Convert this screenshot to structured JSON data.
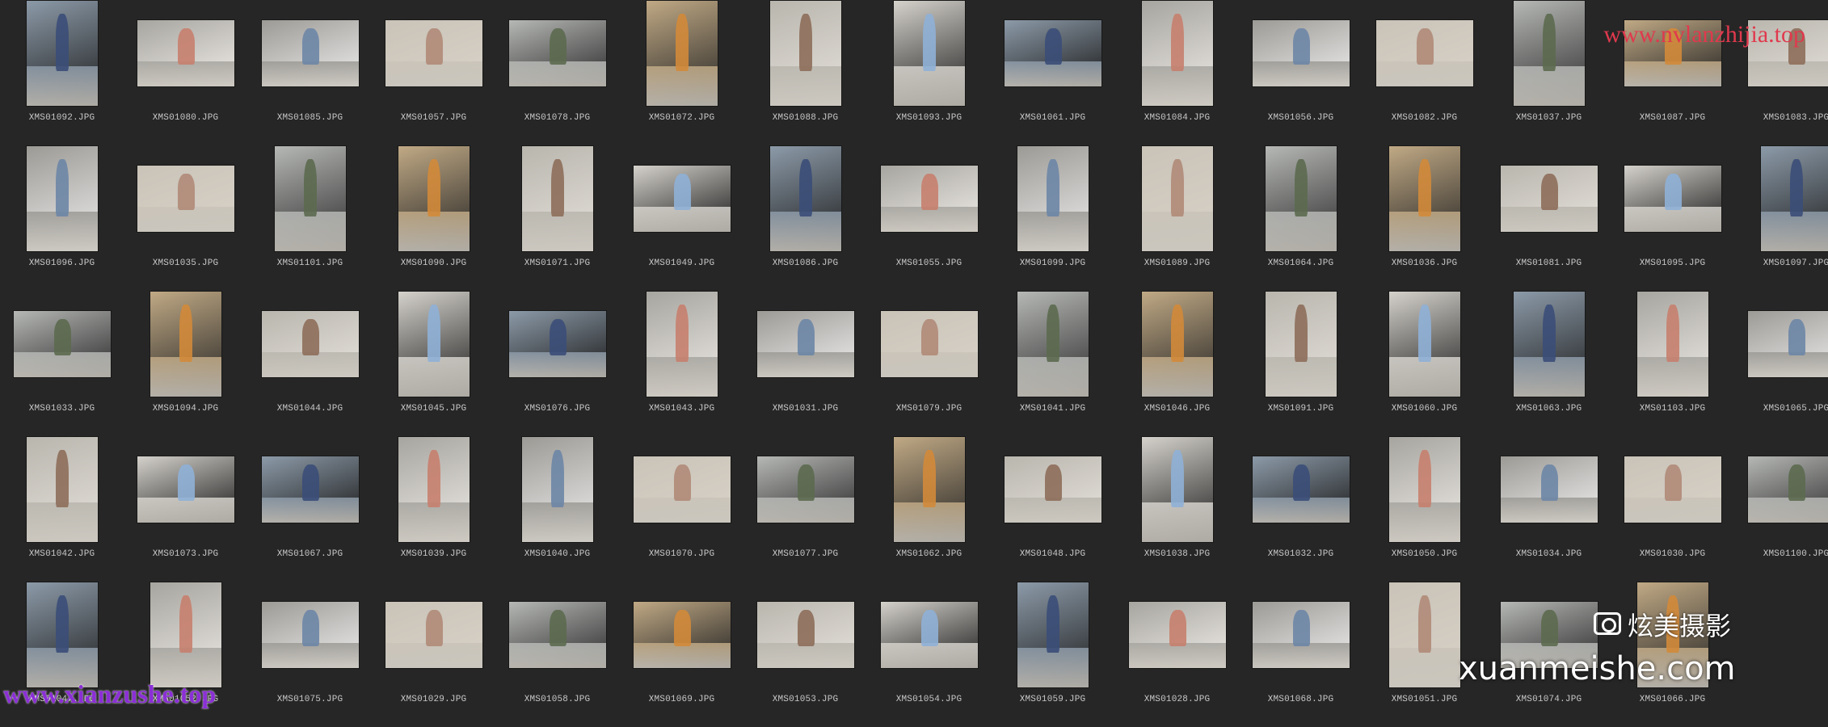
{
  "theme": {
    "background": "#262626",
    "label_color": "#c8c8c8"
  },
  "files": [
    "XMS01092.JPG",
    "XMS01080.JPG",
    "XMS01085.JPG",
    "XMS01057.JPG",
    "XMS01078.JPG",
    "XMS01072.JPG",
    "XMS01088.JPG",
    "XMS01093.JPG",
    "XMS01061.JPG",
    "XMS01084.JPG",
    "XMS01056.JPG",
    "XMS01082.JPG",
    "XMS01037.JPG",
    "XMS01087.JPG",
    "XMS01083.JPG",
    "XMS01096.JPG",
    "XMS01035.JPG",
    "XMS01101.JPG",
    "XMS01090.JPG",
    "XMS01071.JPG",
    "XMS01049.JPG",
    "XMS01086.JPG",
    "XMS01055.JPG",
    "XMS01099.JPG",
    "XMS01089.JPG",
    "XMS01064.JPG",
    "XMS01036.JPG",
    "XMS01081.JPG",
    "XMS01095.JPG",
    "XMS01097.JPG",
    "XMS01033.JPG",
    "XMS01094.JPG",
    "XMS01044.JPG",
    "XMS01045.JPG",
    "XMS01076.JPG",
    "XMS01043.JPG",
    "XMS01031.JPG",
    "XMS01079.JPG",
    "XMS01041.JPG",
    "XMS01046.JPG",
    "XMS01091.JPG",
    "XMS01060.JPG",
    "XMS01063.JPG",
    "XMS01103.JPG",
    "XMS01065.JPG",
    "XMS01042.JPG",
    "XMS01073.JPG",
    "XMS01067.JPG",
    "XMS01039.JPG",
    "XMS01040.JPG",
    "XMS01070.JPG",
    "XMS01077.JPG",
    "XMS01062.JPG",
    "XMS01048.JPG",
    "XMS01038.JPG",
    "XMS01032.JPG",
    "XMS01050.JPG",
    "XMS01034.JPG",
    "XMS01030.JPG",
    "XMS01100.JPG",
    "XMS01047.JPG",
    "XMS01052.JPG",
    "XMS01075.JPG",
    "XMS01029.JPG",
    "XMS01058.JPG",
    "XMS01069.JPG",
    "XMS01053.JPG",
    "XMS01054.JPG",
    "XMS01059.JPG",
    "XMS01028.JPG",
    "XMS01068.JPG",
    "XMS01051.JPG",
    "XMS01074.JPG",
    "XMS01066.JPG"
  ],
  "orientation": [
    "p",
    "l",
    "l",
    "l",
    "l",
    "p",
    "p",
    "p",
    "l",
    "p",
    "l",
    "l",
    "p",
    "l",
    "l",
    "p",
    "l",
    "p",
    "p",
    "p",
    "l",
    "p",
    "l",
    "p",
    "p",
    "p",
    "p",
    "l",
    "l",
    "p",
    "l",
    "p",
    "l",
    "p",
    "l",
    "p",
    "l",
    "l",
    "p",
    "p",
    "p",
    "p",
    "p",
    "p",
    "l",
    "p",
    "l",
    "l",
    "p",
    "p",
    "l",
    "l",
    "p",
    "l",
    "p",
    "l",
    "p",
    "l",
    "l",
    "l",
    "p",
    "p",
    "l",
    "l",
    "l",
    "l",
    "l",
    "l",
    "p",
    "l",
    "l",
    "p",
    "l",
    "p"
  ],
  "watermarks": {
    "top_right": "www.nvlanzhijia.top",
    "bottom_left": "www.xianzushe.top",
    "logo_text": "炫美摄影",
    "bottom_right": "xuanmeishe.com"
  }
}
